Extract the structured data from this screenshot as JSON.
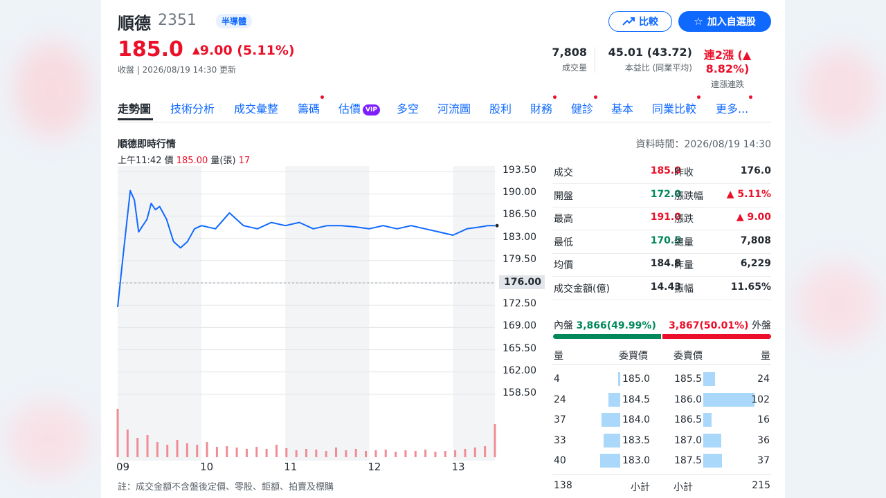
{
  "header": {
    "name": "順德",
    "code": "2351",
    "sector": "半導體",
    "price": "185.0",
    "change": "9.00 (5.11%)",
    "status_line": "收盤 | 2026/08/19 14:30 更新",
    "compare_label": "比較",
    "watchlist_label": "加入自選股",
    "stats": [
      {
        "value": "7,808",
        "label": "成交量"
      },
      {
        "value": "45.01 (43.72)",
        "label": "本益比 (同業平均)"
      },
      {
        "value": "連2漲 (▲ 8.82%)",
        "label": "連漲連跌"
      }
    ]
  },
  "tabs": [
    {
      "label": "走勢圖",
      "active": true,
      "dot": false
    },
    {
      "label": "技術分析",
      "dot": false
    },
    {
      "label": "成交彙整",
      "dot": false
    },
    {
      "label": "籌碼",
      "dot": true
    },
    {
      "label": "估價",
      "dot": false,
      "badge": "VIP"
    },
    {
      "label": "多空",
      "dot": false
    },
    {
      "label": "河流圖",
      "dot": false
    },
    {
      "label": "股利",
      "dot": false
    },
    {
      "label": "財務",
      "dot": true
    },
    {
      "label": "健診",
      "dot": true
    },
    {
      "label": "基本",
      "dot": false
    },
    {
      "label": "同業比較",
      "dot": true
    },
    {
      "label": "更多...",
      "dot": true
    }
  ],
  "section": {
    "title": "順德即時行情",
    "data_time": "資料時間：2026/08/19 14:30",
    "hover": {
      "time": "上午11:42",
      "price_label": "價",
      "price": "185.00",
      "volume_label": "量(張)",
      "volume": "17"
    },
    "footnote": "註：成交金額不含盤後定價、零股、鉅額、拍賣及標購"
  },
  "chart_data": {
    "type": "line",
    "ylim": [
      158.5,
      193.5
    ],
    "y_ticks": [
      "193.50",
      "190.00",
      "186.50",
      "183.00",
      "179.50",
      "176.00",
      "172.50",
      "169.00",
      "165.50",
      "162.00",
      "158.50"
    ],
    "reference_price": 176.0,
    "reference_label": "176.00",
    "x_ticks": [
      "09",
      "10",
      "11",
      "12",
      "13"
    ],
    "series": [
      {
        "time": [
          "09:00",
          "09:03",
          "09:06",
          "09:09",
          "09:12",
          "09:15",
          "09:18",
          "09:21",
          "09:24",
          "09:27",
          "09:30",
          "09:35",
          "09:40",
          "09:45",
          "09:50",
          "09:55",
          "10:00",
          "10:10",
          "10:20",
          "10:30",
          "10:40",
          "10:50",
          "11:00",
          "11:10",
          "11:20",
          "11:30",
          "11:40",
          "11:50",
          "12:00",
          "12:10",
          "12:20",
          "12:30",
          "12:40",
          "12:50",
          "13:00",
          "13:10",
          "13:20",
          "13:25",
          "13:30"
        ],
        "price": [
          172.2,
          178.5,
          184.5,
          190.5,
          189.0,
          184.0,
          185.0,
          186.0,
          188.5,
          187.5,
          188.0,
          186.0,
          182.5,
          181.5,
          182.5,
          184.5,
          185.0,
          184.5,
          187.0,
          185.0,
          184.5,
          185.5,
          185.0,
          185.5,
          184.5,
          185.0,
          185.0,
          184.8,
          184.5,
          185.0,
          184.5,
          185.0,
          184.5,
          184.0,
          183.5,
          184.5,
          184.8,
          185.0,
          185.0
        ]
      }
    ],
    "volume": [
      70,
      40,
      28,
      32,
      22,
      18,
      25,
      20,
      18,
      22,
      15,
      16,
      14,
      12,
      15,
      12,
      18,
      13,
      10,
      12,
      11,
      9,
      14,
      10,
      12,
      9,
      10,
      11,
      8,
      10,
      9,
      11,
      8,
      9,
      10,
      12,
      14,
      16,
      48
    ]
  },
  "quote": {
    "left": [
      {
        "label": "成交",
        "value": "185.0",
        "color": "red"
      },
      {
        "label": "開盤",
        "value": "172.0",
        "color": "green"
      },
      {
        "label": "最高",
        "value": "191.0",
        "color": "red"
      },
      {
        "label": "最低",
        "value": "170.5",
        "color": "green"
      },
      {
        "label": "均價",
        "value": "184.8",
        "color": "dark"
      },
      {
        "label": "成交金額(億)",
        "value": "14.43",
        "color": "dark"
      }
    ],
    "right": [
      {
        "label": "昨收",
        "value": "176.0",
        "color": "dark"
      },
      {
        "label": "漲跌幅",
        "value": "▲ 5.11%",
        "color": "red"
      },
      {
        "label": "漲跌",
        "value": "▲ 9.00",
        "color": "red"
      },
      {
        "label": "總量",
        "value": "7,808",
        "color": "dark"
      },
      {
        "label": "昨量",
        "value": "6,229",
        "color": "dark"
      },
      {
        "label": "振幅",
        "value": "11.65%",
        "color": "dark"
      }
    ],
    "inner": {
      "label": "內盤",
      "value": "3,866(49.99%)",
      "fraction": 0.4999
    },
    "outer": {
      "label": "外盤",
      "value": "3,867(50.01%)",
      "fraction": 0.5001
    }
  },
  "orderbook": {
    "bid_headers": [
      "量",
      "委買價"
    ],
    "ask_headers": [
      "委賣價",
      "量"
    ],
    "bids": [
      {
        "qty": "4",
        "price": "185.0",
        "n": 4
      },
      {
        "qty": "24",
        "price": "184.5",
        "n": 24
      },
      {
        "qty": "37",
        "price": "184.0",
        "n": 37
      },
      {
        "qty": "33",
        "price": "183.5",
        "n": 33
      },
      {
        "qty": "40",
        "price": "183.0",
        "n": 40
      }
    ],
    "asks": [
      {
        "price": "185.5",
        "qty": "24",
        "n": 24
      },
      {
        "price": "186.0",
        "qty": "102",
        "n": 102
      },
      {
        "price": "186.5",
        "qty": "16",
        "n": 16
      },
      {
        "price": "187.0",
        "qty": "36",
        "n": 36
      },
      {
        "price": "187.5",
        "qty": "37",
        "n": 37
      }
    ],
    "bid_subtotal": {
      "qty": "138",
      "label": "小計"
    },
    "ask_subtotal": {
      "label": "小計",
      "qty": "215"
    }
  },
  "colors": {
    "up": "#eb0f29",
    "down": "#00875a",
    "accent": "#0f69ff",
    "line": "#0f69ff",
    "volume": "#f08c96"
  }
}
